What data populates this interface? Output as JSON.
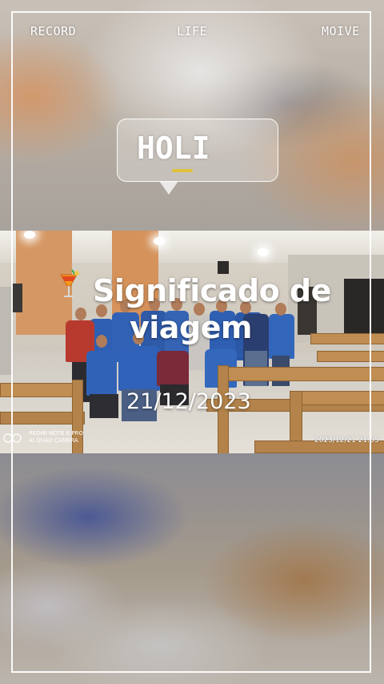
{
  "nav": {
    "left": "RECORD",
    "center": "LIFE",
    "right": "MOIVE"
  },
  "bubble": {
    "title": "HOLI"
  },
  "overlay": {
    "title_line1": "Significado de",
    "title_line2": "viagem",
    "date": "21/12/2023",
    "icon": "cocktail-icon"
  },
  "photo": {
    "watermark_line1": "REDMI NOTE 8 PRO",
    "watermark_line2": "AI QUAD CAMERA",
    "timestamp": "2023/12/21  21:05"
  },
  "colors": {
    "frame": "#ffffff",
    "shirt_blue": "#2f5fb3",
    "shirt_red": "#b83a2e",
    "pew_wood": "#b3834b"
  }
}
